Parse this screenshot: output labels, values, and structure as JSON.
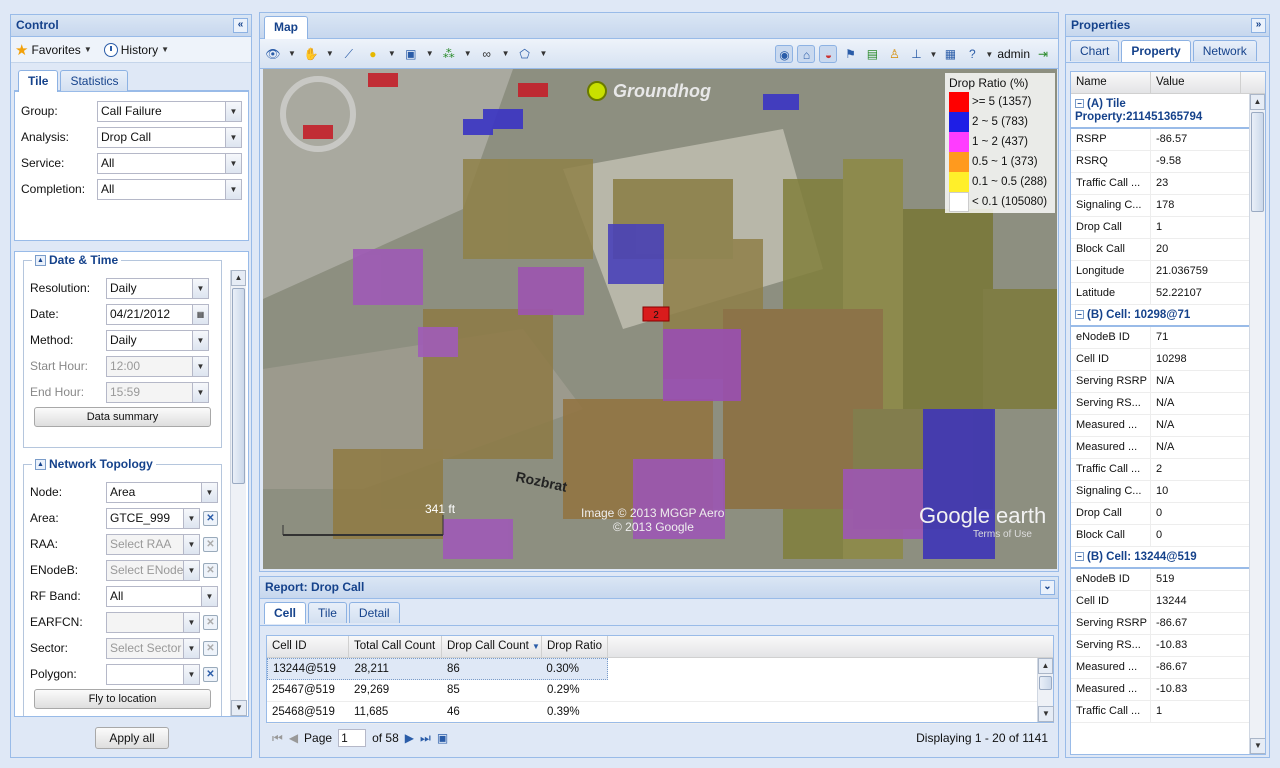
{
  "control": {
    "title": "Control",
    "favorites": "Favorites",
    "history": "History",
    "tabs": [
      "Tile",
      "Statistics"
    ],
    "filters": [
      {
        "label": "Group:",
        "value": "Call Failure"
      },
      {
        "label": "Analysis:",
        "value": "Drop Call"
      },
      {
        "label": "Service:",
        "value": "All"
      },
      {
        "label": "Completion:",
        "value": "All"
      }
    ],
    "datetime": {
      "title": "Date & Time",
      "resolution_label": "Resolution:",
      "resolution": "Daily",
      "date_label": "Date:",
      "date": "04/21/2012",
      "method_label": "Method:",
      "method": "Daily",
      "start_label": "Start Hour:",
      "start": "12:00",
      "end_label": "End Hour:",
      "end": "15:59",
      "summary_button": "Data summary"
    },
    "topology": {
      "title": "Network Topology",
      "node_label": "Node:",
      "node": "Area",
      "area_label": "Area:",
      "area": "GTCE_999",
      "raa_label": "RAA:",
      "raa_placeholder": "Select RAA",
      "enodeb_label": "ENodeB:",
      "enodeb_placeholder": "Select ENodeB",
      "rfband_label": "RF Band:",
      "rfband": "All",
      "earfcn_label": "EARFCN:",
      "sector_label": "Sector:",
      "sector_placeholder": "Select Sector",
      "polygon_label": "Polygon:",
      "fly_button": "Fly to location"
    },
    "apply_button": "Apply all"
  },
  "map": {
    "tab": "Map",
    "user": "admin",
    "brand": "Groundhog",
    "scale": "341 ft",
    "attribution": [
      "Image © 2013 MGGP Aero",
      "© 2013 Google"
    ],
    "google": "Google earth",
    "terms": "Terms of Use",
    "street_labels": [
      "Rozbrat"
    ],
    "marker": "2",
    "legend": {
      "title": "Drop Ratio (%)",
      "items": [
        {
          "label": ">= 5 (1357)",
          "color": "#ff0000"
        },
        {
          "label": "2 ~ 5 (783)",
          "color": "#1e1ee6"
        },
        {
          "label": "1 ~ 2 (437)",
          "color": "#ff3cff"
        },
        {
          "label": "0.5 ~ 1 (373)",
          "color": "#ff9a1e"
        },
        {
          "label": "0.1 ~ 0.5 (288)",
          "color": "#ffef2a"
        },
        {
          "label": "< 0.1 (105080)",
          "color": "#ffffff"
        }
      ]
    }
  },
  "report": {
    "title": "Report: Drop Call",
    "tabs": [
      "Cell",
      "Tile",
      "Detail"
    ],
    "columns": [
      "Cell ID",
      "Total Call Count",
      "Drop Call Count",
      "Drop Ratio"
    ],
    "rows": [
      [
        "13244@519",
        "28,211",
        "86",
        "0.30%"
      ],
      [
        "25467@519",
        "29,269",
        "85",
        "0.29%"
      ],
      [
        "25468@519",
        "11,685",
        "46",
        "0.39%"
      ]
    ],
    "page_label": "Page",
    "page": "1",
    "of": "of 58",
    "display": "Displaying 1 - 20 of 1141"
  },
  "properties": {
    "title": "Properties",
    "tabs": [
      "Chart",
      "Property",
      "Network"
    ],
    "columns": [
      "Name",
      "Value"
    ],
    "groupA": {
      "title": "(A) Tile Property:211451365794",
      "rows": [
        [
          "RSRP",
          "-86.57"
        ],
        [
          "RSRQ",
          "-9.58"
        ],
        [
          "Traffic Call ...",
          "23"
        ],
        [
          "Signaling C...",
          "178"
        ],
        [
          "Drop Call",
          "1"
        ],
        [
          "Block Call",
          "20"
        ],
        [
          "Longitude",
          "21.036759"
        ],
        [
          "Latitude",
          "52.22107"
        ]
      ]
    },
    "groupB1": {
      "title": "(B) Cell: 10298@71",
      "rows": [
        [
          "eNodeB ID",
          "71"
        ],
        [
          "Cell ID",
          "10298"
        ],
        [
          "Serving RSRP",
          "N/A"
        ],
        [
          "Serving RS...",
          "N/A"
        ],
        [
          "Measured ...",
          "N/A"
        ],
        [
          "Measured ...",
          "N/A"
        ],
        [
          "Traffic Call ...",
          "2"
        ],
        [
          "Signaling C...",
          "10"
        ],
        [
          "Drop Call",
          "0"
        ],
        [
          "Block Call",
          "0"
        ]
      ]
    },
    "groupB2": {
      "title": "(B) Cell: 13244@519",
      "rows": [
        [
          "eNodeB ID",
          "519"
        ],
        [
          "Cell ID",
          "13244"
        ],
        [
          "Serving RSRP",
          "-86.67"
        ],
        [
          "Serving RS...",
          "-10.83"
        ],
        [
          "Measured ...",
          "-86.67"
        ],
        [
          "Measured ...",
          "-10.83"
        ],
        [
          "Traffic Call ...",
          "1"
        ]
      ]
    }
  }
}
